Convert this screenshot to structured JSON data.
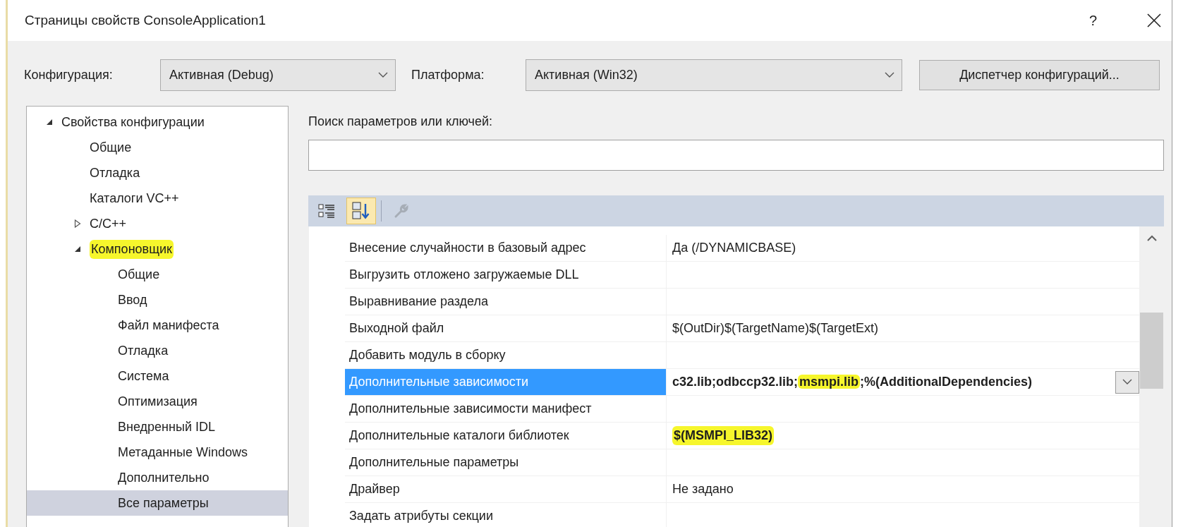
{
  "window": {
    "title": "Страницы свойств ConsoleApplication1",
    "help_button": "?"
  },
  "configuration": {
    "label": "Конфигурация:",
    "value": "Активная (Debug)"
  },
  "platform": {
    "label": "Платформа:",
    "value": "Активная (Win32)"
  },
  "config_manager_button": {
    "label": "Диспетчер конфигураций..."
  },
  "tree": [
    {
      "label": "Свойства конфигурации",
      "expanded": true,
      "selected": false,
      "highlighted": false,
      "children": [
        {
          "label": "Общие",
          "selected": false,
          "highlighted": false
        },
        {
          "label": "Отладка",
          "selected": false,
          "highlighted": false
        },
        {
          "label": "Каталоги VC++",
          "selected": false,
          "highlighted": false
        },
        {
          "label": "C/C++",
          "expanded": false,
          "selected": false,
          "highlighted": false
        },
        {
          "label": "Компоновщик",
          "expanded": true,
          "selected": false,
          "highlighted": true,
          "children": [
            {
              "label": "Общие",
              "selected": false,
              "highlighted": false
            },
            {
              "label": "Ввод",
              "selected": false,
              "highlighted": false
            },
            {
              "label": "Файл манифеста",
              "selected": false,
              "highlighted": false
            },
            {
              "label": "Отладка",
              "selected": false,
              "highlighted": false
            },
            {
              "label": "Система",
              "selected": false,
              "highlighted": false
            },
            {
              "label": "Оптимизация",
              "selected": false,
              "highlighted": false
            },
            {
              "label": "Внедренный IDL",
              "selected": false,
              "highlighted": false
            },
            {
              "label": "Метаданные Windows",
              "selected": false,
              "highlighted": false
            },
            {
              "label": "Дополнительно",
              "selected": false,
              "highlighted": false
            },
            {
              "label": "Все параметры",
              "selected": true,
              "highlighted": false
            }
          ]
        }
      ]
    }
  ],
  "search": {
    "label": "Поиск параметров или ключей:"
  },
  "toolbar": [
    {
      "kind": "categorized",
      "selected": false,
      "disabled": false
    },
    {
      "kind": "alphabetical",
      "selected": true,
      "disabled": false
    },
    {
      "kind": "property_pages",
      "selected": false,
      "disabled": true
    }
  ],
  "properties": [
    {
      "name": "Внесение случайности в базовый адрес",
      "value": "Да (/DYNAMICBASE)",
      "selected": false,
      "bold": false,
      "highlighted": false
    },
    {
      "name": "Выгрузить отложено загружаемые DLL",
      "selected": false
    },
    {
      "name": "Выравнивание раздела",
      "selected": false
    },
    {
      "name": "Выходной файл",
      "value": "$(OutDir)$(TargetName)$(TargetExt)",
      "selected": false,
      "bold": false,
      "highlighted": false
    },
    {
      "name": "Добавить модуль в сборку",
      "selected": false
    },
    {
      "name": "Дополнительные зависимости",
      "selected": true,
      "bold": true,
      "dropdown": true,
      "value_parts": [
        {
          "text": "c32.lib;odbccp32.lib;",
          "highlighted": false
        },
        {
          "text": "msmpi.lib",
          "highlighted": true
        },
        {
          "text": ";%(AdditionalDependencies)",
          "highlighted": false
        }
      ]
    },
    {
      "name": "Дополнительные зависимости манифест",
      "selected": false
    },
    {
      "name": "Дополнительные каталоги библиотек",
      "value": "$(MSMPI_LIB32)",
      "selected": false,
      "bold": true,
      "highlighted": true
    },
    {
      "name": "Дополнительные параметры",
      "selected": false
    },
    {
      "name": "Драйвер",
      "value": "Не задано",
      "selected": false,
      "bold": false,
      "highlighted": false
    },
    {
      "name": "Задать атрибуты секции",
      "selected": false
    }
  ]
}
